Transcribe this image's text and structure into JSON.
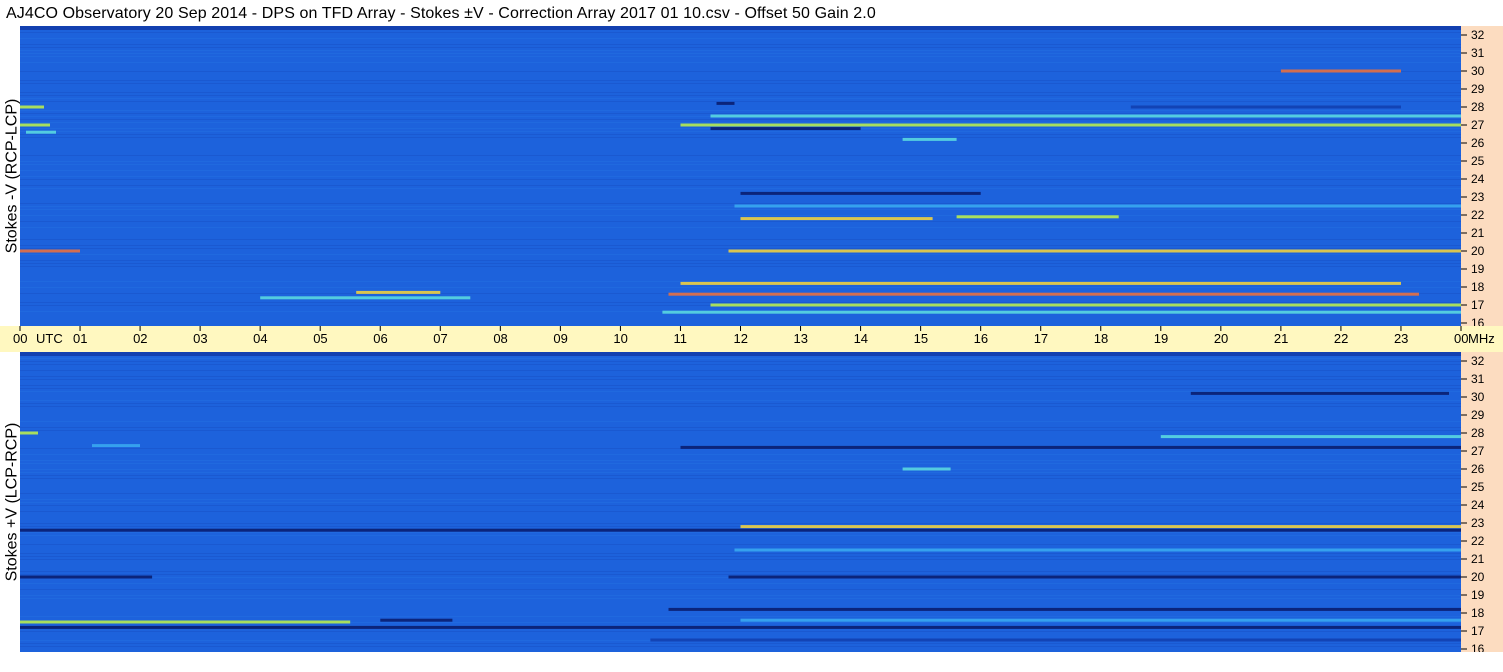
{
  "title": "AJ4CO Observatory  20 Sep 2014  -  DPS on TFD Array  -  Stokes ±V  -  Correction Array 2017 01 10.csv  -  Offset 50  Gain 2.0",
  "colors": {
    "background": "#1d62dc",
    "freq_axis_bg": "#fcdcc0",
    "time_axis_bg": "#fff8c0",
    "palette": [
      "#0a1e70",
      "#1240b0",
      "#1d62dc",
      "#2a80e8",
      "#39a8f0",
      "#5ad8e0",
      "#b8ec50",
      "#f0d040",
      "#e87040"
    ]
  },
  "chart_data": {
    "type": "heatmap",
    "time_axis": {
      "unit_label": "UTC",
      "end_label": "MHz",
      "ticks": [
        "00",
        "01",
        "02",
        "03",
        "04",
        "05",
        "06",
        "07",
        "08",
        "09",
        "10",
        "11",
        "12",
        "13",
        "14",
        "15",
        "16",
        "17",
        "18",
        "19",
        "20",
        "21",
        "22",
        "23",
        "00"
      ],
      "range": [
        0,
        24
      ]
    },
    "freq_axis": {
      "ticks": [
        "32",
        "31",
        "30",
        "29",
        "28",
        "27",
        "26",
        "25",
        "24",
        "23",
        "22",
        "21",
        "20",
        "19",
        "18",
        "17",
        "16"
      ],
      "range": [
        16,
        32
      ]
    },
    "panels": [
      {
        "label": "Stokes -V (RCP-LCP)",
        "features": [
          {
            "f": 28.0,
            "t0": 0.0,
            "t1": 0.4,
            "level": 6
          },
          {
            "f": 27.0,
            "t0": 0.0,
            "t1": 0.5,
            "level": 6
          },
          {
            "f": 26.6,
            "t0": 0.1,
            "t1": 0.6,
            "level": 5
          },
          {
            "f": 17.7,
            "t0": 5.6,
            "t1": 7.0,
            "level": 7
          },
          {
            "f": 17.4,
            "t0": 4.0,
            "t1": 7.5,
            "level": 5
          },
          {
            "f": 20.0,
            "t0": 0.0,
            "t1": 1.0,
            "level": 8
          },
          {
            "f": 20.0,
            "t0": 11.8,
            "t1": 24.0,
            "level": 7
          },
          {
            "f": 21.8,
            "t0": 12.0,
            "t1": 15.2,
            "level": 7
          },
          {
            "f": 21.9,
            "t0": 15.6,
            "t1": 18.3,
            "level": 6
          },
          {
            "f": 18.2,
            "t0": 11.0,
            "t1": 23.0,
            "level": 7
          },
          {
            "f": 17.6,
            "t0": 10.8,
            "t1": 23.3,
            "level": 8
          },
          {
            "f": 17.0,
            "t0": 11.5,
            "t1": 24.0,
            "level": 6
          },
          {
            "f": 16.6,
            "t0": 10.7,
            "t1": 24.0,
            "level": 5
          },
          {
            "f": 27.0,
            "t0": 11.0,
            "t1": 24.0,
            "level": 6
          },
          {
            "f": 27.5,
            "t0": 11.5,
            "t1": 24.0,
            "level": 5
          },
          {
            "f": 26.2,
            "t0": 14.7,
            "t1": 15.6,
            "level": 5
          },
          {
            "f": 22.5,
            "t0": 11.9,
            "t1": 24.0,
            "level": 4
          },
          {
            "f": 28.0,
            "t0": 18.5,
            "t1": 23.0,
            "level": 1
          },
          {
            "f": 30.0,
            "t0": 21.0,
            "t1": 23.0,
            "level": 8
          },
          {
            "f": 28.2,
            "t0": 11.6,
            "t1": 11.9,
            "level": 0
          },
          {
            "f": 26.8,
            "t0": 11.5,
            "t1": 14.0,
            "level": 0
          },
          {
            "f": 23.2,
            "t0": 12.0,
            "t1": 16.0,
            "level": 0
          }
        ]
      },
      {
        "label": "Stokes +V (LCP-RCP)",
        "features": [
          {
            "f": 28.0,
            "t0": 0.0,
            "t1": 0.3,
            "level": 6
          },
          {
            "f": 27.3,
            "t0": 1.2,
            "t1": 2.0,
            "level": 4
          },
          {
            "f": 17.5,
            "t0": 0.0,
            "t1": 5.5,
            "level": 6
          },
          {
            "f": 17.6,
            "t0": 6.0,
            "t1": 7.2,
            "level": 0
          },
          {
            "f": 20.0,
            "t0": 0.0,
            "t1": 2.2,
            "level": 0
          },
          {
            "f": 20.0,
            "t0": 11.8,
            "t1": 24.0,
            "level": 0
          },
          {
            "f": 22.8,
            "t0": 12.0,
            "t1": 24.0,
            "level": 7
          },
          {
            "f": 22.6,
            "t0": 0.0,
            "t1": 24.0,
            "level": 0
          },
          {
            "f": 18.2,
            "t0": 10.8,
            "t1": 24.0,
            "level": 0
          },
          {
            "f": 17.2,
            "t0": 0.0,
            "t1": 24.0,
            "level": 0
          },
          {
            "f": 17.6,
            "t0": 12.0,
            "t1": 24.0,
            "level": 4
          },
          {
            "f": 27.2,
            "t0": 11.0,
            "t1": 24.0,
            "level": 0
          },
          {
            "f": 27.8,
            "t0": 19.0,
            "t1": 24.0,
            "level": 5
          },
          {
            "f": 30.2,
            "t0": 19.5,
            "t1": 23.8,
            "level": 0
          },
          {
            "f": 26.0,
            "t0": 14.7,
            "t1": 15.5,
            "level": 5
          },
          {
            "f": 21.5,
            "t0": 11.9,
            "t1": 24.0,
            "level": 4
          },
          {
            "f": 16.5,
            "t0": 10.5,
            "t1": 24.0,
            "level": 1
          }
        ]
      }
    ]
  }
}
